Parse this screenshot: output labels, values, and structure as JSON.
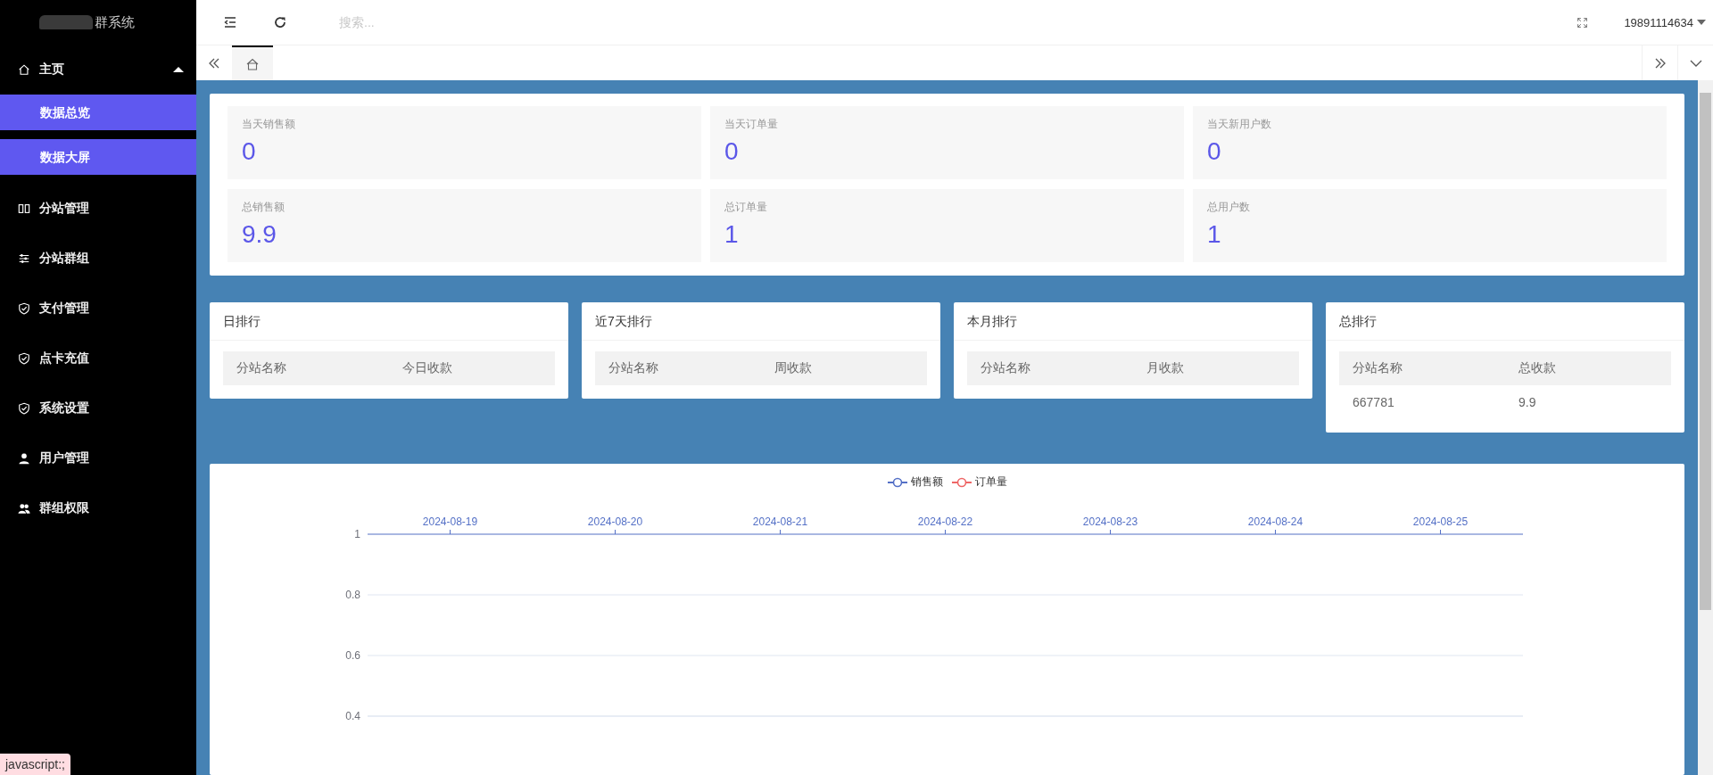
{
  "sidebar": {
    "logo": "群系统",
    "items": [
      {
        "label": "主页",
        "expanded": true,
        "children": [
          {
            "label": "数据总览",
            "selected": true
          },
          {
            "label": "数据大屏",
            "selected": true
          }
        ]
      },
      {
        "label": "分站管理"
      },
      {
        "label": "分站群组"
      },
      {
        "label": "支付管理"
      },
      {
        "label": "点卡充值"
      },
      {
        "label": "系统设置"
      },
      {
        "label": "用户管理"
      },
      {
        "label": "群组权限"
      }
    ]
  },
  "topbar": {
    "search": {
      "placeholder": "搜索..."
    },
    "user": "19891114634"
  },
  "tabs": [
    {
      "kind": "home",
      "selected": true
    }
  ],
  "stats": [
    {
      "label": "当天销售额",
      "value": "0"
    },
    {
      "label": "当天订单量",
      "value": "0"
    },
    {
      "label": "当天新用户数",
      "value": "0"
    },
    {
      "label": "总销售额",
      "value": "9.9"
    },
    {
      "label": "总订单量",
      "value": "1"
    },
    {
      "label": "总用户数",
      "value": "1"
    }
  ],
  "rankings": [
    {
      "title": "日排行",
      "columns": [
        "分站名称",
        "今日收款"
      ]
    },
    {
      "title": "近7天排行",
      "columns": [
        "分站名称",
        "周收款"
      ]
    },
    {
      "title": "本月排行",
      "columns": [
        "分站名称",
        "月收款"
      ]
    },
    {
      "title": "总排行",
      "columns": [
        "分站名称",
        "总收款"
      ],
      "rows": [
        [
          "667781",
          "9.9"
        ]
      ]
    }
  ],
  "chart": {
    "chart_data": {
      "type": "line",
      "categories": [
        "2024-08-19",
        "2024-08-20",
        "2024-08-21",
        "2024-08-22",
        "2024-08-23",
        "2024-08-24",
        "2024-08-25"
      ],
      "series": [
        {
          "name": "销售额",
          "color": "#5470c6",
          "values": [
            null,
            null,
            null,
            null,
            null,
            null,
            null
          ]
        },
        {
          "name": "订单量",
          "color": "#ee6666",
          "values": [
            null,
            null,
            null,
            null,
            null,
            null,
            null
          ]
        }
      ],
      "ylim": [
        0.4,
        1
      ],
      "grid": true,
      "yticks": [
        0.4,
        0.6,
        0.8,
        1
      ]
    }
  },
  "status_bar": {
    "text": "javascript:;"
  }
}
